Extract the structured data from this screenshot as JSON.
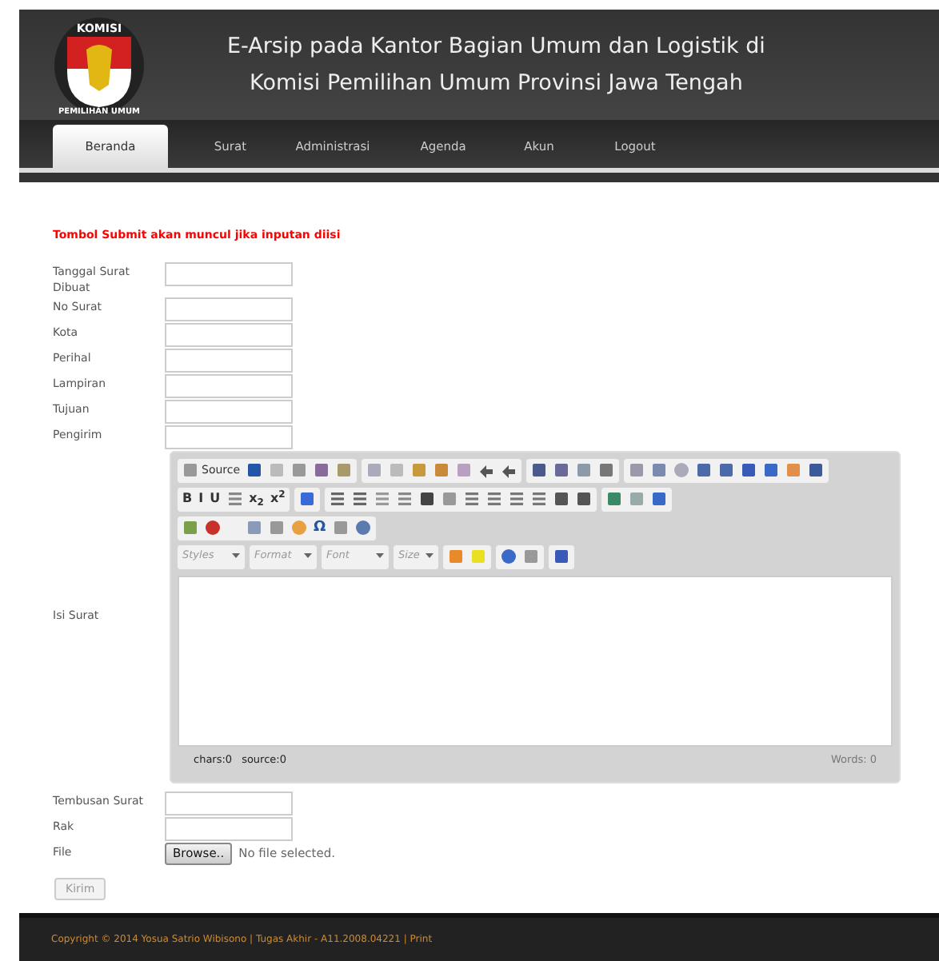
{
  "header": {
    "logo_top": "KOMISI",
    "logo_bottom": "PEMILIHAN UMUM",
    "title_lines": [
      "E-Arsip pada Kantor Bagian Umum dan Logistik di",
      "Komisi Pemilihan Umum Provinsi Jawa Tengah"
    ]
  },
  "nav": [
    {
      "label": "Beranda",
      "selected": true
    },
    {
      "label": "Surat",
      "selected": false
    },
    {
      "label": "Administrasi",
      "selected": false
    },
    {
      "label": "Agenda",
      "selected": false
    },
    {
      "label": "Akun",
      "selected": false
    },
    {
      "label": "Logout",
      "selected": false
    }
  ],
  "notice": "Tombol Submit akan muncul jika inputan diisi",
  "fields_top": [
    {
      "label": "Tanggal Surat Dibuat"
    },
    {
      "label": "No Surat"
    },
    {
      "label": "Kota"
    },
    {
      "label": "Perihal"
    },
    {
      "label": "Lampiran"
    },
    {
      "label": "Tujuan"
    },
    {
      "label": "Pengirim"
    }
  ],
  "editor": {
    "label": "Isi Surat",
    "source_button": "Source",
    "format_buttons": [
      "B",
      "I",
      "U",
      "x$_{2}$",
      "x$^{2}$"
    ],
    "omega": "Ω",
    "dropdowns": [
      "Styles",
      "Format",
      "Font",
      "Size"
    ],
    "chars": "chars:0",
    "source": "source:0",
    "words": "Words: 0"
  },
  "fields_bottom": [
    {
      "label": "Tembusan Surat"
    },
    {
      "label": "Rak"
    }
  ],
  "file": {
    "label": "File",
    "button": "Browse..",
    "status": "No file selected."
  },
  "submit": {
    "label": "Kirim",
    "disabled": true
  },
  "footer": "Copyright © 2014 Yosua Satrio Wibisono | Tugas Akhir - A11.2008.04221 | Print"
}
